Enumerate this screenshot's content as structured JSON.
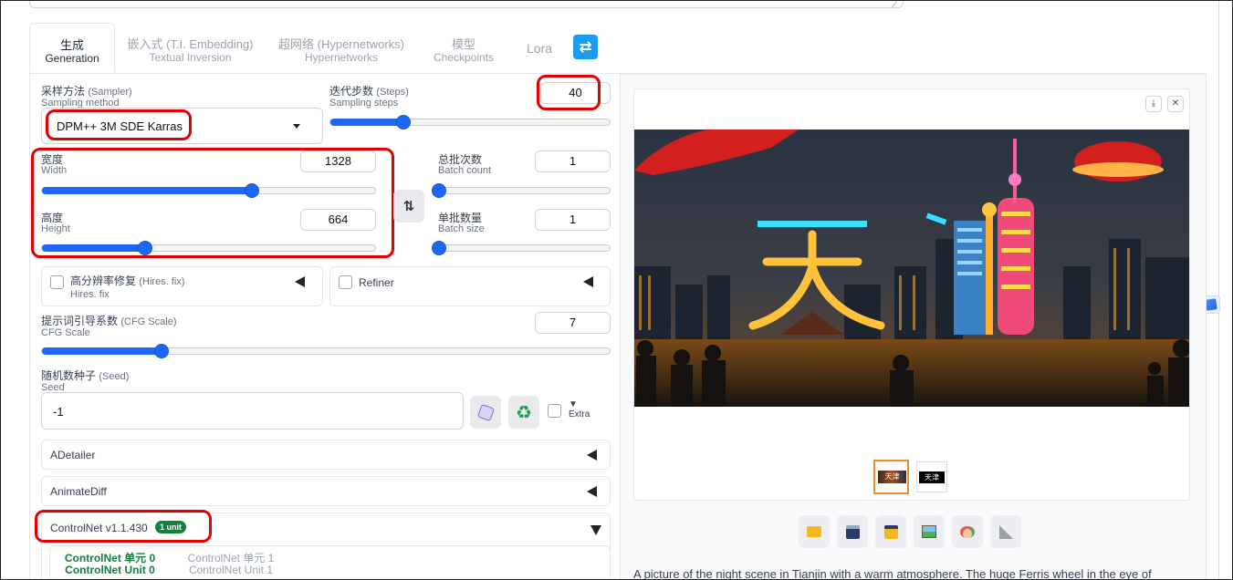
{
  "tabs": [
    {
      "zh": "生成",
      "en": "Generation"
    },
    {
      "zh": "嵌入式 (T.I. Embedding)",
      "en": "Textual Inversion"
    },
    {
      "zh": "超网络 (Hypernetworks)",
      "en": "Hypernetworks"
    },
    {
      "zh": "模型",
      "en": "Checkpoints"
    },
    {
      "zh": "Lora",
      "en": ""
    }
  ],
  "refresh_icon": "refresh-icon",
  "sampler": {
    "label_zh": "采样方法",
    "label_en": "(Sampler)",
    "sub": "Sampling method",
    "value": "DPM++ 3M SDE Karras"
  },
  "steps": {
    "label_zh": "迭代步数",
    "label_en": "(Steps)",
    "sub": "Sampling steps",
    "value": "40",
    "fraction": 0.26
  },
  "width": {
    "label_zh": "宽度",
    "sub": "Width",
    "value": "1328",
    "fraction": 0.63
  },
  "height": {
    "label_zh": "高度",
    "sub": "Height",
    "value": "664",
    "fraction": 0.31
  },
  "batch_count": {
    "label_zh": "总批次数",
    "sub": "Batch count",
    "value": "1",
    "fraction": 0.0
  },
  "batch_size": {
    "label_zh": "单批数量",
    "sub": "Batch size",
    "value": "1",
    "fraction": 0.0
  },
  "swap_icon": "swap-vertical-icon",
  "hires": {
    "label_zh": "高分辨率修复",
    "label_en": "(Hires. fix)",
    "sub": "Hires. fix"
  },
  "refiner": {
    "label": "Refiner"
  },
  "cfg": {
    "label_zh": "提示词引导系数",
    "label_en": "(CFG Scale)",
    "sub": "CFG Scale",
    "value": "7",
    "fraction": 0.21
  },
  "seed": {
    "label_zh": "随机数种子",
    "label_en": "(Seed)",
    "sub": "Seed",
    "value": "-1",
    "extra": "Extra"
  },
  "accordions": {
    "adetailer": "ADetailer",
    "animatediff": "AnimateDiff",
    "controlnet": "ControlNet v1.1.430",
    "controlnet_badge": "1 unit"
  },
  "controlnet_units": [
    {
      "zh": "ControlNet 单元 0",
      "en": "ControlNet Unit 0",
      "active": true
    },
    {
      "zh": "ControlNet 单元 1",
      "en": "ControlNet Unit 1",
      "active": false
    }
  ],
  "gallery": {
    "thumb_text": "天津",
    "download_icon": "download-icon",
    "close_icon": "close-icon"
  },
  "toolbar_icons": [
    "folder-icon",
    "save-icon",
    "zip-save-icon",
    "image-send-icon",
    "palette-icon",
    "ruler-icon"
  ],
  "caption": "A picture of the night scene in Tianjin with a warm atmosphere. The huge Ferris wheel in the eye of",
  "colors": {
    "accent": "#1e66f5",
    "highlight": "#e10000",
    "badge": "#15803d",
    "refresh": "#1d9bf0"
  }
}
